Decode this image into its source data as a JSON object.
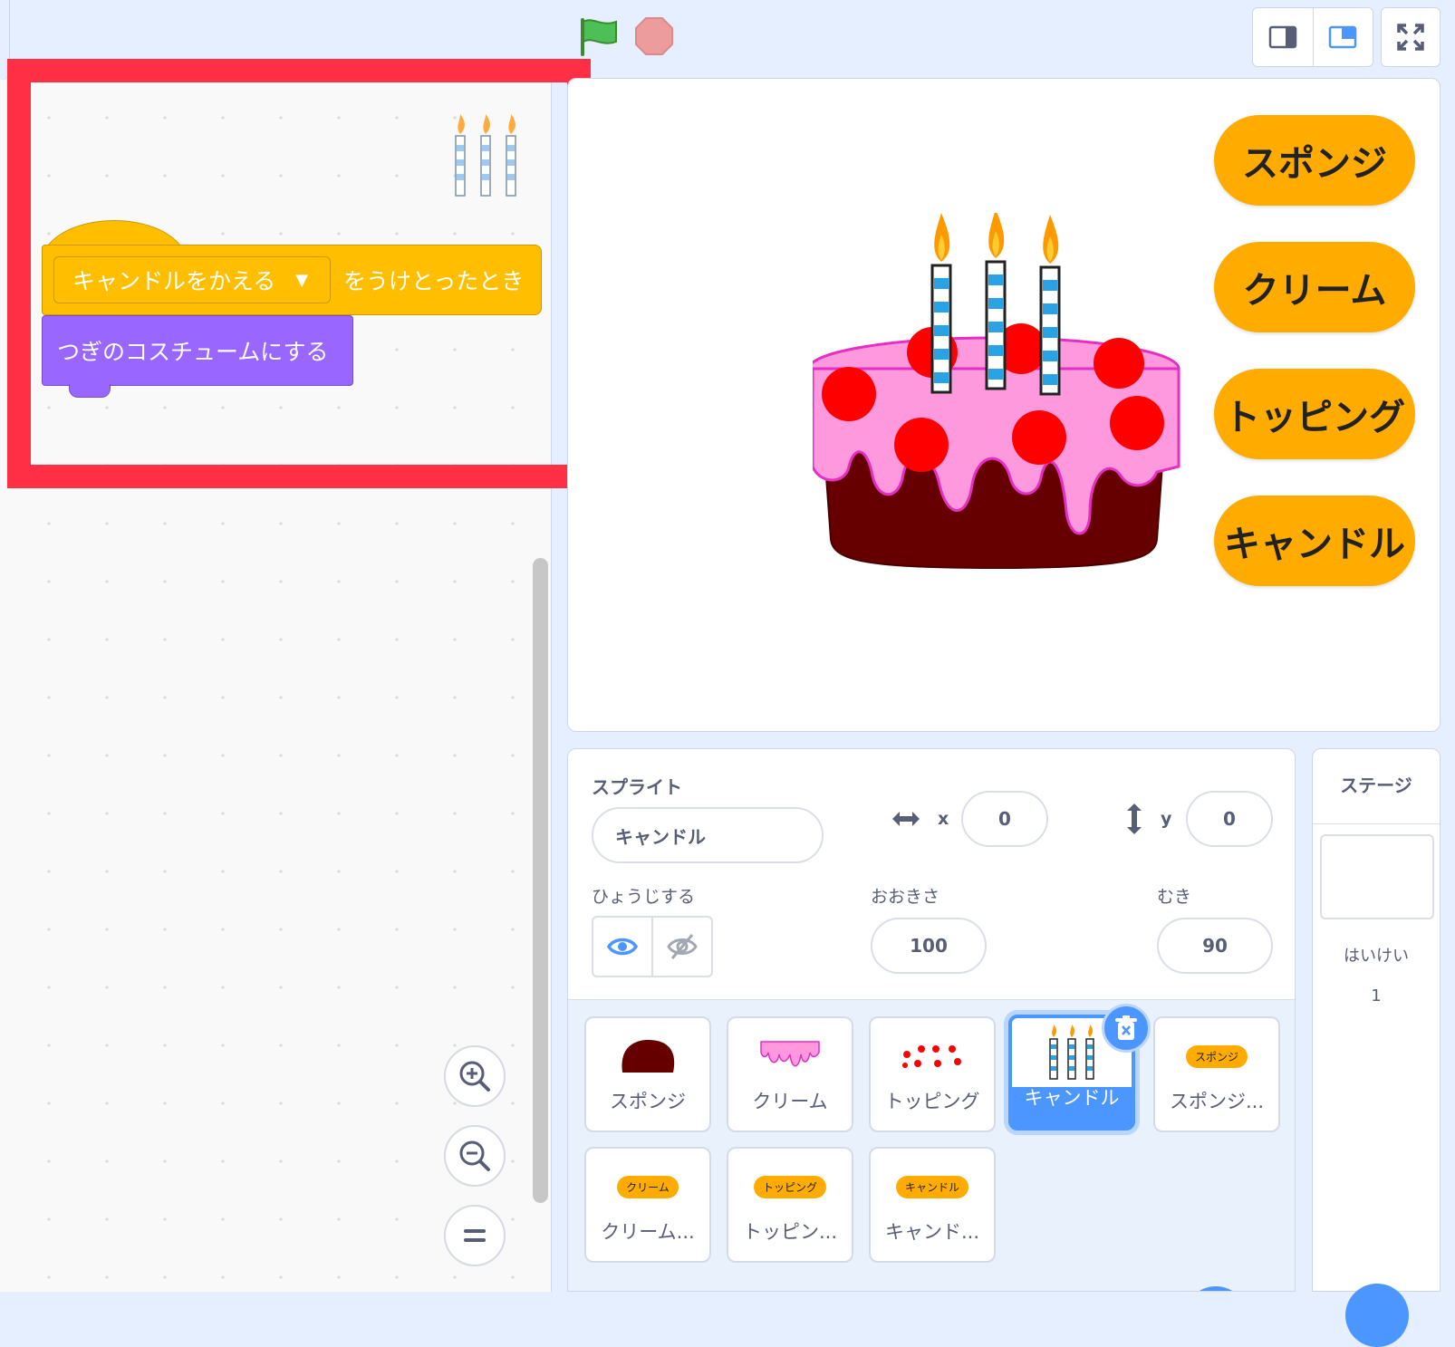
{
  "controls": {
    "green_flag": "green-flag-icon",
    "stop": "stop-icon"
  },
  "script": {
    "hat_message": "キャンドルをかえる",
    "hat_suffix": "をうけとったとき",
    "stack_block": "つぎのコスチュームにする"
  },
  "stage_buttons": [
    "スポンジ",
    "クリーム",
    "トッピング",
    "キャンドル"
  ],
  "sprite_info": {
    "title": "スプライト",
    "name": "キャンドル",
    "x_label": "x",
    "x_value": "0",
    "y_label": "y",
    "y_value": "0",
    "show_label": "ひょうじする",
    "size_label": "おおきさ",
    "size_value": "100",
    "direction_label": "むき",
    "direction_value": "90"
  },
  "sprites": [
    {
      "name": "スポンジ",
      "thumb": "sponge"
    },
    {
      "name": "クリーム",
      "thumb": "cream"
    },
    {
      "name": "トッピング",
      "thumb": "topping"
    },
    {
      "name": "キャンドル",
      "thumb": "candles",
      "selected": true
    },
    {
      "name": "スポンジ...",
      "thumb": "pill",
      "pill": "スポンジ"
    },
    {
      "name": "クリーム...",
      "thumb": "pill",
      "pill": "クリーム"
    },
    {
      "name": "トッピン...",
      "thumb": "pill",
      "pill": "トッピング"
    },
    {
      "name": "キャンド...",
      "thumb": "pill",
      "pill": "キャンドル"
    }
  ],
  "stage_panel": {
    "title": "ステージ",
    "backdrops_label": "はいけい",
    "backdrops_count": "1"
  },
  "colors": {
    "accent": "#4c97ff",
    "events": "#ffbf00",
    "looks": "#9966ff",
    "highlight": "#ff2f46",
    "stage_button": "#ffab00"
  }
}
